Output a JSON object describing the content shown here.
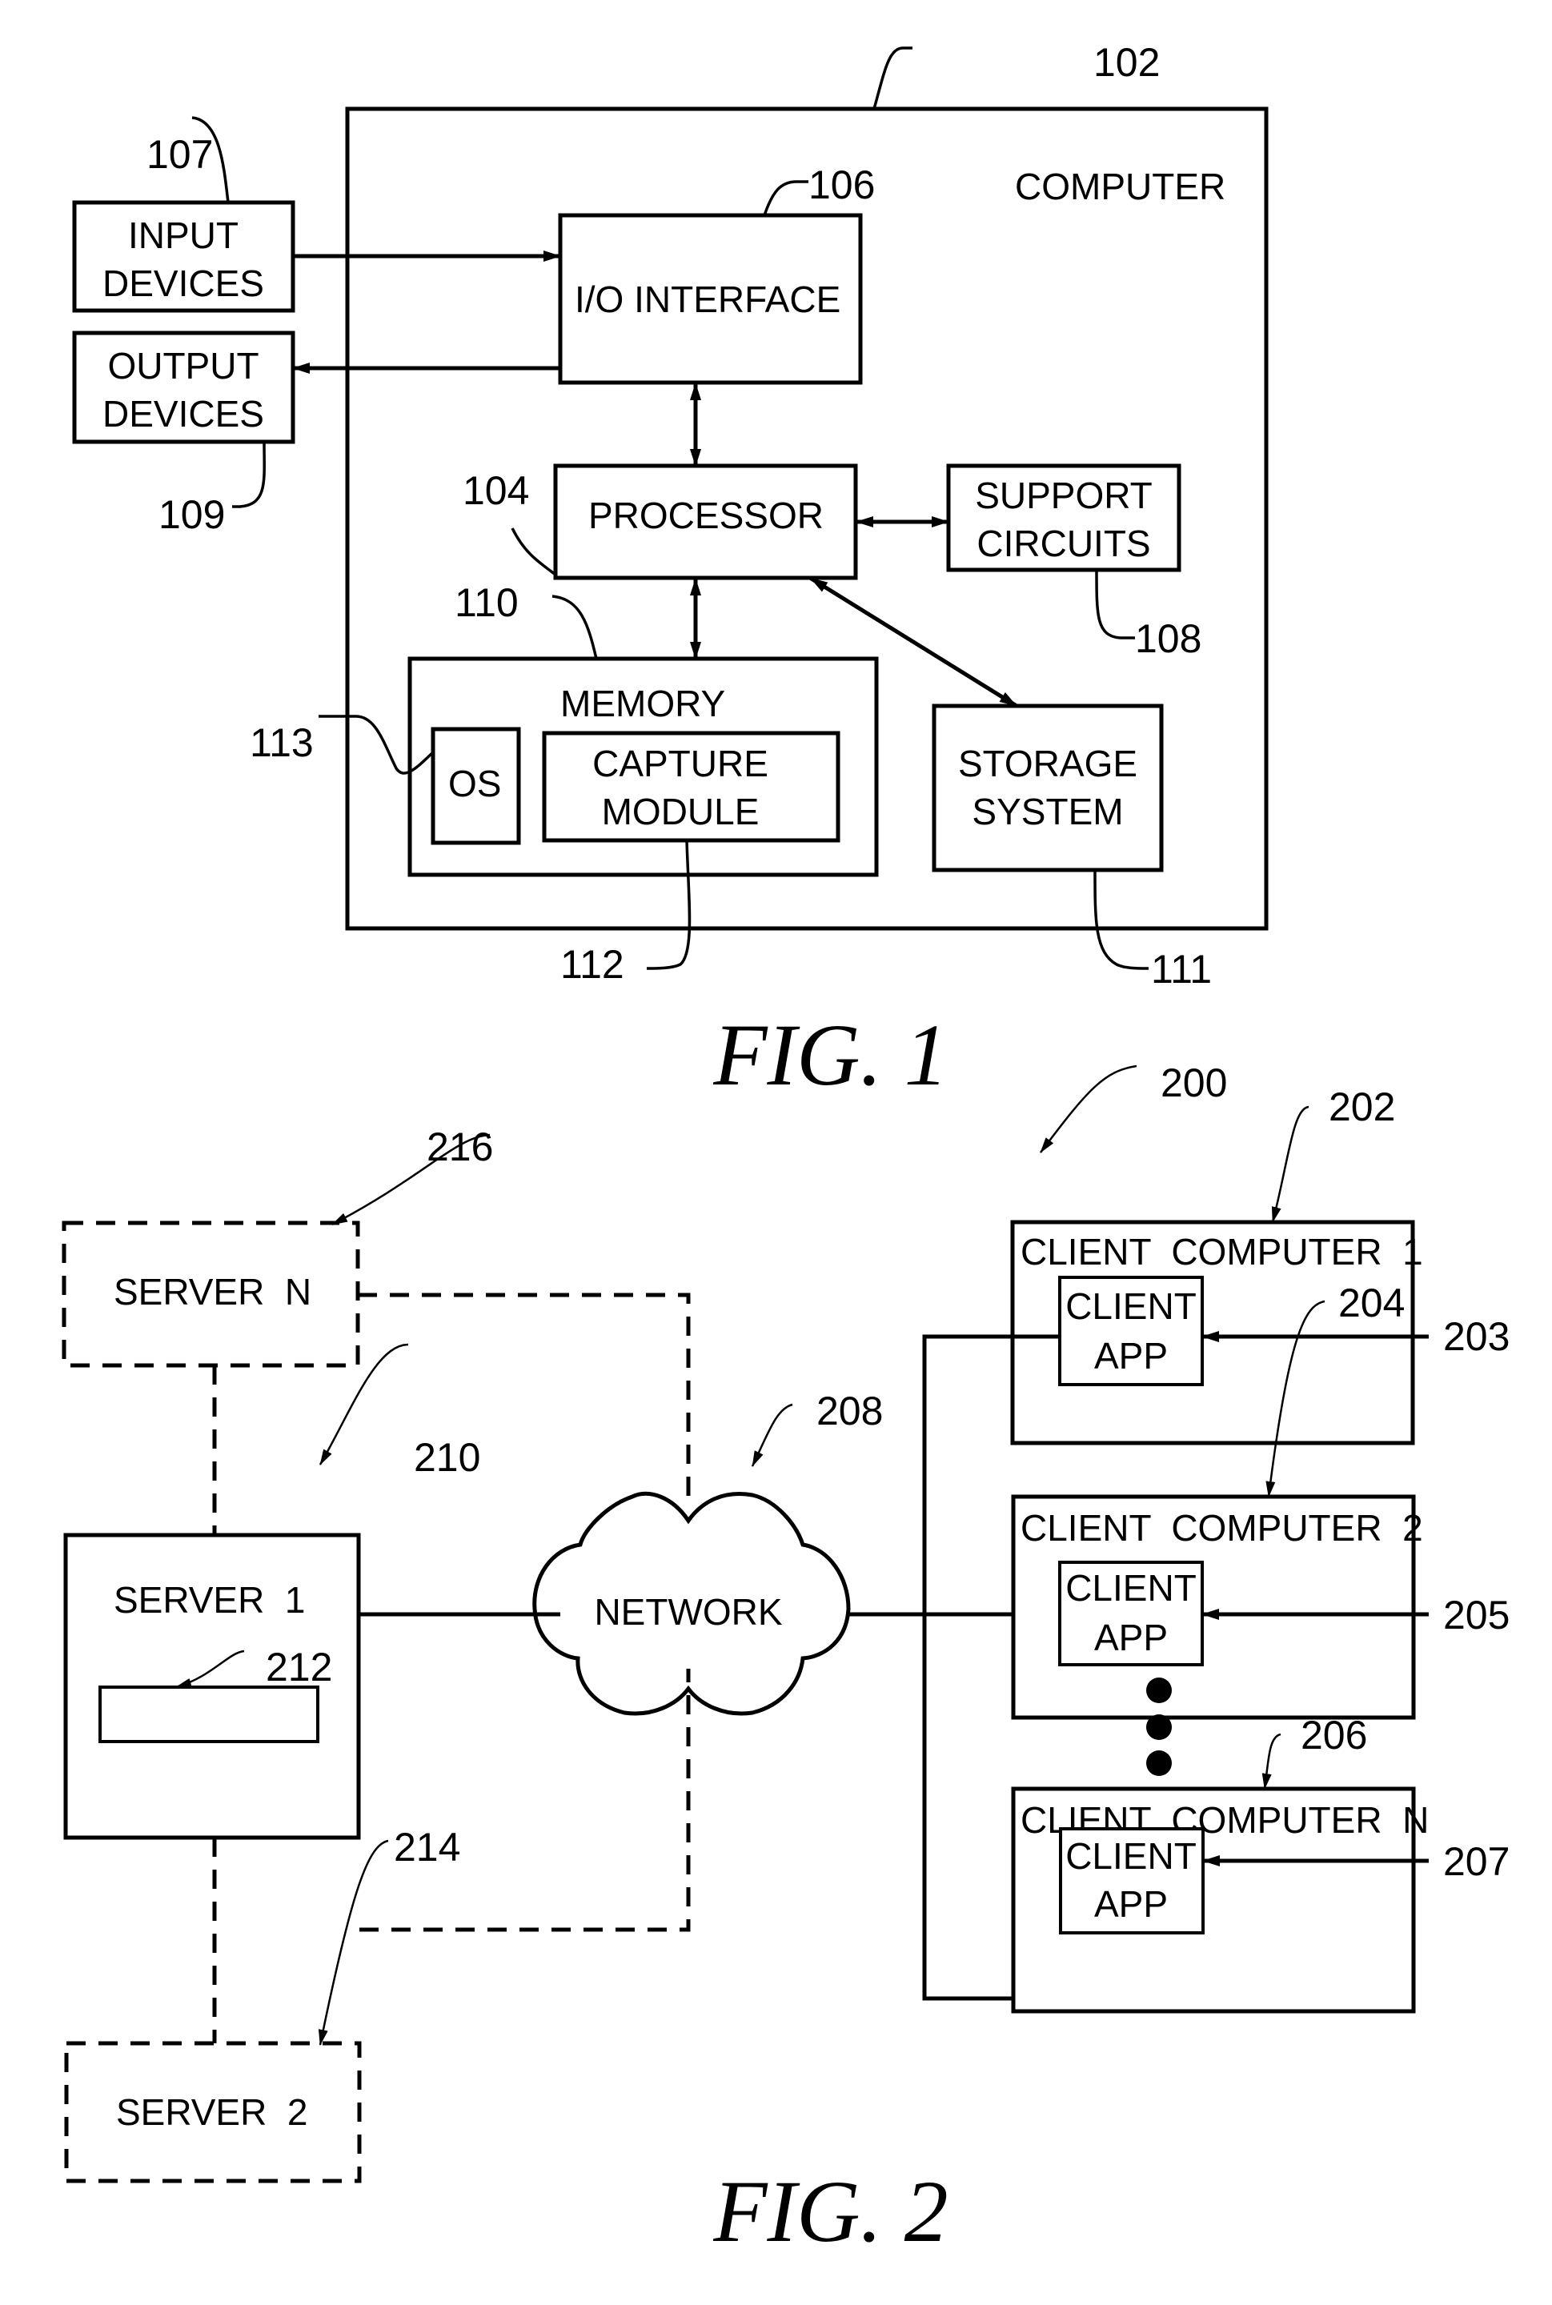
{
  "figure1": {
    "caption": "FIG. 1",
    "computer": {
      "label": "COMPUTER",
      "ref": "102"
    },
    "io_interface": {
      "label": "I/O INTERFACE",
      "ref": "106"
    },
    "input_devices": {
      "line1": "INPUT",
      "line2": "DEVICES",
      "ref": "107"
    },
    "output_devices": {
      "line1": "OUTPUT",
      "line2": "DEVICES",
      "ref": "109"
    },
    "processor": {
      "label": "PROCESSOR",
      "ref": "104"
    },
    "support_circuits": {
      "line1": "SUPPORT",
      "line2": "CIRCUITS",
      "ref": "108"
    },
    "memory": {
      "label": "MEMORY",
      "ref": "110"
    },
    "os": {
      "label": "OS",
      "ref": "113"
    },
    "capture_module": {
      "line1": "CAPTURE",
      "line2": "MODULE",
      "ref": "112"
    },
    "storage_system": {
      "line1": "STORAGE",
      "line2": "SYSTEM",
      "ref": "111"
    }
  },
  "figure2": {
    "caption": "FIG. 2",
    "system_ref": "200",
    "network": {
      "label": "NETWORK",
      "ref": "208"
    },
    "server_n": {
      "label": "SERVER  N",
      "ref": "216"
    },
    "server_1": {
      "label": "SERVER  1",
      "ref": "210",
      "inner_ref": "212"
    },
    "server_2": {
      "label": "SERVER  2",
      "ref": "214"
    },
    "clients": [
      {
        "label": "CLIENT  COMPUTER  1",
        "ref": "202",
        "app_line1": "CLIENT",
        "app_line2": "APP",
        "app_ref": "203"
      },
      {
        "label": "CLIENT  COMPUTER  2",
        "ref": "204",
        "app_line1": "CLIENT",
        "app_line2": "APP",
        "app_ref": "205"
      },
      {
        "label": "CLIENT  COMPUTER  N",
        "ref": "206",
        "app_line1": "CLIENT",
        "app_line2": "APP",
        "app_ref": "207"
      }
    ],
    "ellipsis_dots": 3
  }
}
